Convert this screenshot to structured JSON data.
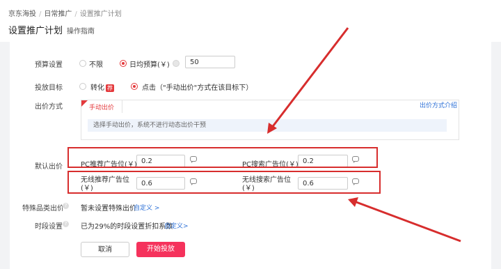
{
  "breadcrumb": [
    "京东海投",
    "日常推广",
    "设置推广计划"
  ],
  "page": {
    "title": "设置推广计划",
    "guide": "操作指南"
  },
  "budget": {
    "label": "预算设置",
    "opt_unlimited": "不限",
    "opt_daily": "日均预算(￥)",
    "value": "50"
  },
  "target": {
    "label": "投放目标",
    "opt_convert": "转化",
    "convert_tag": "荐",
    "opt_click": "点击（\"手动出价\"方式在该目标下）"
  },
  "bid": {
    "label": "出价方式",
    "tab": "手动出价",
    "info": "选择手动出价，系统不进行动态出价干预",
    "link": "出价方式介绍"
  },
  "default_bid": {
    "label": "默认出价",
    "pc_rec_label": "PC推荐广告位(￥)",
    "pc_rec_value": "0.2",
    "pc_search_label": "PC搜索广告位(￥)",
    "pc_search_value": "0.2",
    "wl_rec_label_1": "无线推荐广告位",
    "wl_rec_label_2": "(￥)",
    "wl_rec_value": "0.6",
    "wl_search_label_1": "无线搜索广告位",
    "wl_search_label_2": "(￥)",
    "wl_search_value": "0.6"
  },
  "special": {
    "label": "特殊品类出价",
    "text": "暂未设置特殊出价",
    "link": "自定义 >"
  },
  "timeslot": {
    "label": "时段设置",
    "text": "已为29%的时段设置折扣系数",
    "link": "自定义>"
  },
  "buttons": {
    "cancel": "取消",
    "start": "开始投放"
  },
  "colors": {
    "accent": "#e4393c",
    "primary_button": "#f5325c",
    "annotation": "#d72d2d",
    "link": "#2b6fd6"
  }
}
